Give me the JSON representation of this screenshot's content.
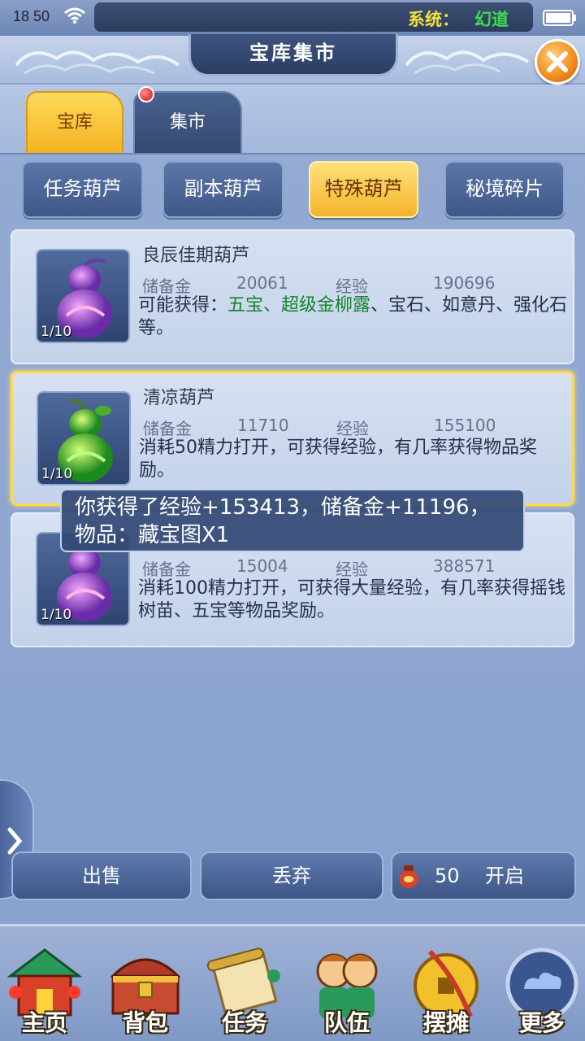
{
  "status_bar": {
    "time": "18 50",
    "system_label": "系统：",
    "system_message": "幻道"
  },
  "header": {
    "title": "宝库集市"
  },
  "tabs": [
    {
      "label": "宝库",
      "active": true
    },
    {
      "label": "集市",
      "active": false,
      "has_red_dot": true
    }
  ],
  "filters": [
    {
      "label": "任务葫芦",
      "active": false
    },
    {
      "label": "副本葫芦",
      "active": false
    },
    {
      "label": "特殊葫芦",
      "active": true
    },
    {
      "label": "秘境碎片",
      "active": false
    }
  ],
  "items": [
    {
      "name": "良辰佳期葫芦",
      "count": "1/10",
      "reserve_label": "储备金",
      "reserve_value": "20061",
      "exp_label": "经验",
      "exp_value": "190696",
      "desc_prefix": "可能获得：",
      "desc_highlight": "五宝、超级金柳露",
      "desc_suffix": "、宝石、如意丹、强化石等。",
      "selected": false
    },
    {
      "name": "清凉葫芦",
      "count": "1/10",
      "reserve_label": "储备金",
      "reserve_value": "11710",
      "exp_label": "经验",
      "exp_value": "155100",
      "desc": "消耗50精力打开，可获得经验，有几率获得物品奖励。",
      "selected": true
    },
    {
      "name": "",
      "count": "1/10",
      "reserve_label": "储备金",
      "reserve_value": "15004",
      "exp_label": "经验",
      "exp_value": "388571",
      "desc": "消耗100精力打开，可获得大量经验，有几率获得摇钱树苗、五宝等物品奖励。",
      "selected": false
    }
  ],
  "toast": {
    "message": "你获得了经验+153413，储备金+11196，物品：藏宝图X1"
  },
  "actions": {
    "sell": "出售",
    "discard": "丢弃",
    "open_cost": "50",
    "open": "开启"
  },
  "nav": [
    {
      "label": "主页",
      "icon": "palace-icon"
    },
    {
      "label": "背包",
      "icon": "treasure-chest-icon"
    },
    {
      "label": "任务",
      "icon": "scroll-icon"
    },
    {
      "label": "队伍",
      "icon": "team-icon"
    },
    {
      "label": "摆摊",
      "icon": "coin-icon"
    },
    {
      "label": "更多",
      "icon": "cloud-orb-icon"
    }
  ],
  "colors": {
    "accent_gold": "#f2b322",
    "panel_blue": "#8aa2cf",
    "highlight_green": "#12842a"
  }
}
